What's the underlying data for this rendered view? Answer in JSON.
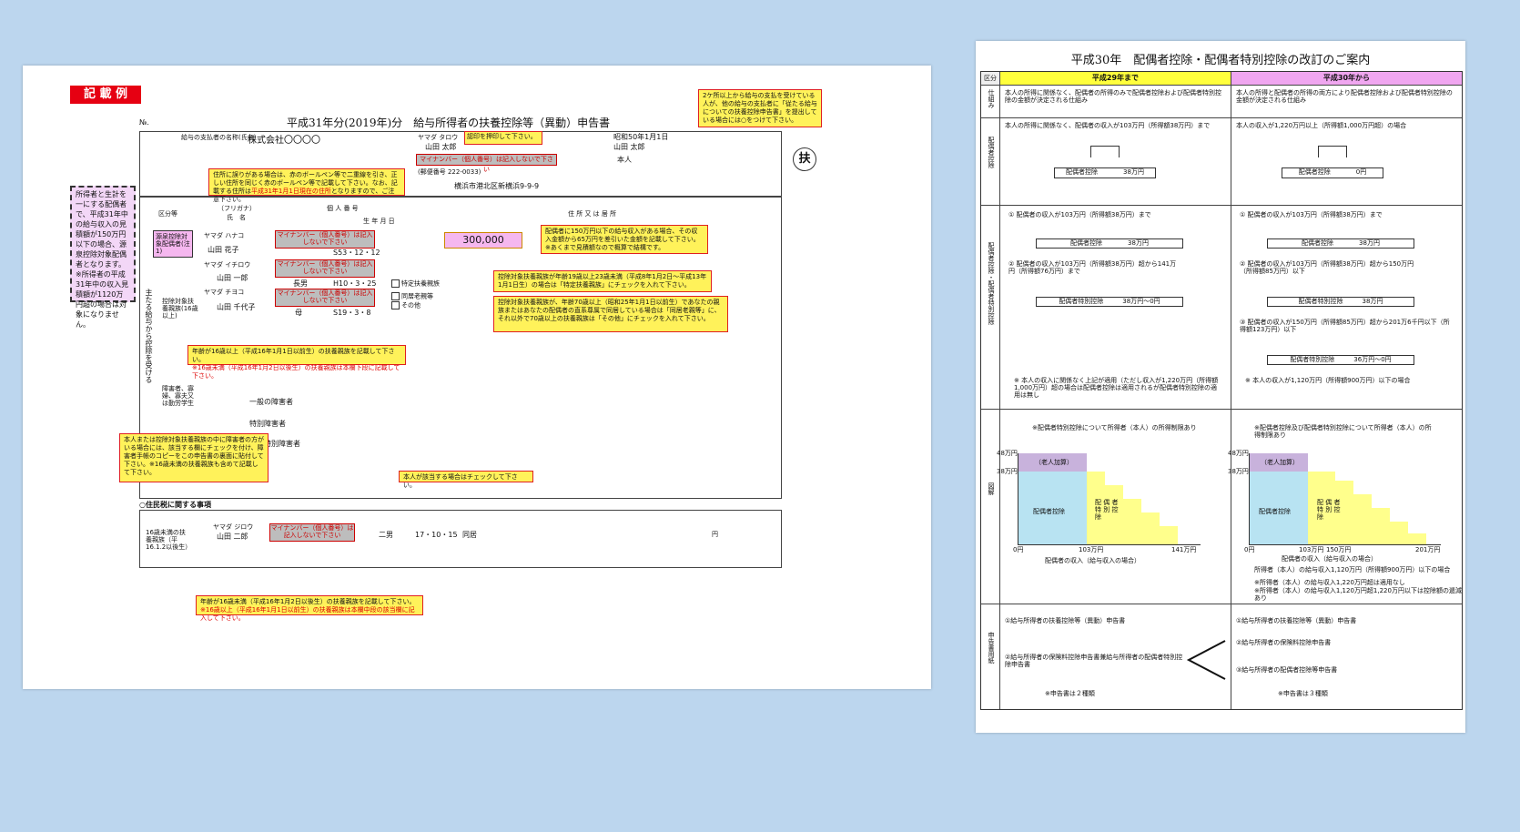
{
  "left": {
    "sample_badge": "記 載 例",
    "number_label": "№.",
    "form_title": "平成31年分(2019年)分　給与所得者の扶養控除等（異動）申告書",
    "employer_name": "株式会社〇〇〇〇",
    "employee_furigana": "ヤマダ タロウ",
    "employee_name": "山田 太郎",
    "stamp_note": "認印を押印して下さい。",
    "birthday": "昭和50年1月1日",
    "householder": "山田 太郎",
    "relation": "本人",
    "mynumber_note": "マイナンバー（個人番号）は記入しないで下さい",
    "postal": "(郵便番号 222-0033)",
    "address": "横浜市港北区新横浜9-9-9",
    "address_note_1": "住所に誤りがある場合は、赤のボールペン等で二重線を引き、正しい住所を同じく赤のボールペン等で記載して下さい。なお、記載する住所は",
    "address_note_2": "平成31年1月1日現在の住所",
    "address_note_3": "となりますので、ご注意下さい。",
    "top_right_note": "2ケ所以上から給与の支払を受けている人が、他の給与の支払者に「従たる給与についての扶養控除申告書」を提出している場合には○をつけて下さい。",
    "fu_mark": "扶",
    "spouse_section": "源泉控除対象配偶者(注1)",
    "spouse_furigana": "ヤマダ ハナコ",
    "spouse_name": "山田 花子",
    "spouse_birth": "S53・12・12",
    "spouse_income": "300,000",
    "spouse_note": "配偶者に150万円以下の給与収入がある場合、その収入金額から65万円を差引いた金額を記載して下さい。※あくまで見積額なので概算で結構です。",
    "dep1_furigana": "ヤマダ イチロウ",
    "dep1_name": "山田 一郎",
    "dep1_relation": "長男",
    "dep1_birth": "H10・3・25",
    "dep2_furigana": "ヤマダ チヨコ",
    "dep2_name": "山田 千代子",
    "dep2_relation": "母",
    "dep2_birth": "S19・3・8",
    "special_note": "控除対象扶養親族が年齢19歳以上23歳未満（平成8年1月2日〜平成13年1月1日生）の場合は「特定扶養親族」にチェックを入れて下さい。",
    "elder_note": "控除対象扶養親族が、年齢70歳以上（昭和25年1月1日以前生）であなたの親族またはあなたの配偶者の直系尊属で同居している場合は「同居老親等」に、それ以外で70歳以上の扶養親族は「その他」にチェックを入れて下さい。",
    "age16_note_1": "年齢が16歳以上（平成16年1月1日以前生）の扶養親族を記載して下さい。",
    "age16_note_2": "※16歳未満（平成16年1月2日以後生）の扶養親族は本欄下段に記載して下さい。",
    "disabled_note": "本人または控除対象扶養親族の中に障害者の方がいる場合には、該当する欄にチェックを付け、障害者手帳のコピーをこの申告書の裏面に貼付して下さい。※16歳未満の扶養親族も含めて記載して下さい。",
    "student_note": "本人が該当する場合はチェックして下さい。",
    "left_note": "所得者と生計を一にする配偶者で、平成31年中の給与収入の見積額が150万円以下の場合、源泉控除対象配偶者となります。※所得者の平成31年中の収入見積額が1120万円超の場合は対象になりません。",
    "resident_header": "○住民税に関する事項",
    "child_section": "16歳未満の扶養親族（平16.1.2以後生）",
    "child_furigana": "ヤマダ ジロウ",
    "child_name": "山田 二郎",
    "child_relation": "二男",
    "child_birth": "17・10・15",
    "child_live": "同居",
    "bottom_note_1": "年齢が16歳未満（平成16年1月2日以後生）の扶養親族を記載して下さい。",
    "bottom_note_2": "※16歳以上（平成16年1月1日以前生）の扶養親族は本欄中段の該当欄に記入して下さい。",
    "labels": {
      "classification": "区分等",
      "furigana": "（フリガナ）",
      "name": "氏　名",
      "personal_no": "個 人 番 号",
      "birth": "生 年 月 日",
      "address": "住 所 又 は 居 所",
      "main_side": "主たる給与から控除を受ける",
      "dependents": "控除対象扶養親族(16歳以上)",
      "disabled": "障害者、寡婦、寡夫又は勤労学生",
      "general": "一般の障害者",
      "special": "特別障害者",
      "together": "同居特別障害者",
      "yen": "円",
      "special_dep": "特定扶養親族",
      "living": "同居老親等",
      "other": "その他"
    }
  },
  "right": {
    "title": "平成30年　配偶者控除・配偶者特別控除の改訂のご案内",
    "col_category": "区分",
    "col_before": "平成29年まで",
    "col_after": "平成30年から",
    "row_labels": [
      "仕組み",
      "配偶者控除",
      "配偶者控除・配偶者特別控除",
      "図解",
      "申告書用紙"
    ],
    "r1_before": "本人の所得に関係なく、配偶者の所得のみで配偶者控除および配偶者特別控除の金額が決定される仕組み",
    "r1_after": "本人の所得と配偶者の所得の両方により配偶者控除および配偶者特別控除の金額が決定される仕組み",
    "r2_before": "本人の所得に関係なく、配偶者の収入が103万円（所得額38万円）まで",
    "r2_after": "本人の収入が1,220万円以上（所得額1,000万円超）の場合",
    "r2_box_before": "配偶者控除　　　　38万円",
    "r2_box_after": "配偶者控除　　　　0円",
    "r3_b1": "① 配偶者の収入が103万円（所得額38万円）まで",
    "r3_b1_box": "配偶者控除　　　　38万円",
    "r3_b2": "② 配偶者の収入が103万円（所得額38万円）超から141万円（所得額76万円）まで",
    "r3_b2_box": "配偶者特別控除　　　38万円〜0円",
    "r3_b_note": "※ 本人の収入に関係なく上記が適用（ただし収入が1,220万円（所得額1,000万円）超の場合は配偶者控除は適用されるが配偶者特別控除の適用は無し",
    "r3_a1": "① 配偶者の収入が103万円（所得額38万円）まで",
    "r3_a1_box": "配偶者控除　　　　38万円",
    "r3_a2": "② 配偶者の収入が103万円（所得額38万円）超から150万円（所得額85万円）以下",
    "r3_a2_box": "配偶者特別控除　　　38万円",
    "r3_a3": "③ 配偶者の収入が150万円（所得額85万円）超から201万6千円以下（所得額123万円）以下",
    "r3_a3_box": "配偶者特別控除　　　36万円〜0円",
    "r3_a_note": "※ 本人の収入が1,120万円（所得額900万円）以下の場合",
    "r4_before_title": "※配偶者特別控除について所得者（本人）の所得制限あり",
    "r4_after_title": "※配偶者控除及び配偶者特別控除について所得者（本人）の所得制限あり",
    "r4_elder": "（老人加算）",
    "r4_spouse": "配偶者控除",
    "r4_special": "配 偶 者 特 別 控 除",
    "r4_y48": "48万円",
    "r4_y38": "38万円",
    "r4_x0": "0円",
    "r4_x103": "103万円",
    "r4_x141": "141万円",
    "r4_x150": "150万円",
    "r4_x201": "201万円",
    "r4_before_caption": "配偶者の収入（給与収入の場合）",
    "r4_after_caption": "配偶者の収入（給与収入の場合）",
    "r4_after_note1": "所得者（本人）の給与収入1,120万円（所得額900万円）以下の場合",
    "r4_after_note2": "※所得者（本人）の給与収入1,220万円超は適用なし",
    "r4_after_note3": "※所得者（本人）の給与収入1,120万円超1,220万円以下は控除額の逓減あり",
    "r5_b1": "①給与所得者の扶養控除等（異動）申告書",
    "r5_b2": "②給与所得者の保険料控除申告書兼給与所得者の配偶者特別控除申告書",
    "r5_b_note": "※申告書は２種類",
    "r5_a1": "①給与所得者の扶養控除等（異動）申告書",
    "r5_a2": "②給与所得者の保険料控除申告書",
    "r5_a3": "③給与所得者の配偶者控除等申告書",
    "r5_a_note": "※申告書は３種類",
    "colors": {
      "before_header": "#ffff3c",
      "after_header": "#f0a6f0",
      "chart_blue": "#b8e3f2",
      "chart_yellow": "#ffff8c",
      "chart_purple": "#c8b2dc"
    }
  }
}
